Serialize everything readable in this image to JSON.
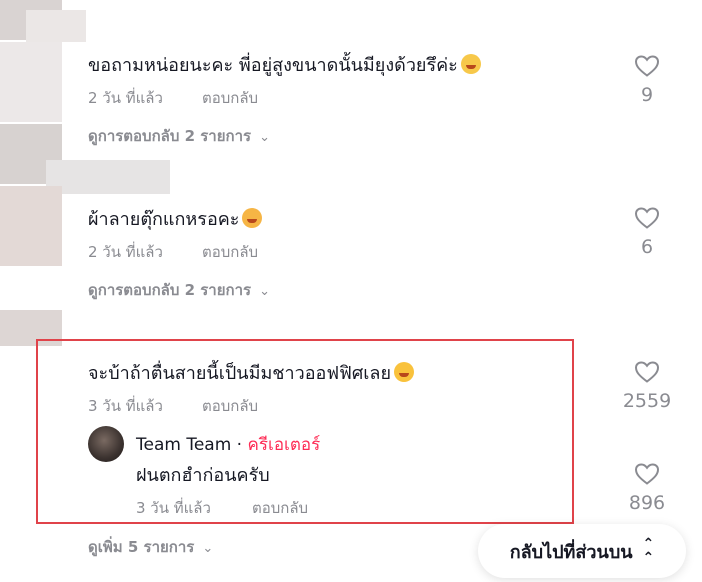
{
  "comments": [
    {
      "text": "ขอถามหน่อยนะคะ พี่อยู่สูงขนาดนั้นมียุงด้วยรึค่ะ",
      "emoji": "smiling-face-with-sweat-emoji",
      "time": "2 วัน ที่แล้ว",
      "reply_label": "ตอบกลับ",
      "likes": "9",
      "view_replies": "ดูการตอบกลับ 2 รายการ"
    },
    {
      "text": "ผ้าลายตุ๊กแกหรอคะ",
      "emoji": "smiling-face-with-hearts-emoji",
      "time": "2 วัน ที่แล้ว",
      "reply_label": "ตอบกลับ",
      "likes": "6",
      "view_replies": "ดูการตอบกลับ 2 รายการ"
    },
    {
      "text": "จะบ้าถ้าตื่นสายนี้เป็นมีมชาวออฟฟิศเลย",
      "emoji": "tears-of-joy-emoji",
      "time": "3 วัน ที่แล้ว",
      "reply_label": "ตอบกลับ",
      "likes": "2559",
      "reply": {
        "author": "Team Team",
        "separator": " · ",
        "badge": "ครีเอเตอร์",
        "text": "ฝนตกฮำก่อนครับ",
        "time": "3 วัน ที่แล้ว",
        "reply_label": "ตอบกลับ",
        "likes": "896"
      },
      "view_more": "ดูเพิ่ม 5 รายการ"
    }
  ],
  "back_to_top": "กลับไปที่ส่วนบน",
  "colors": {
    "text": "#161823",
    "muted": "#8a8b91",
    "creator_badge": "#fe2c55",
    "highlight_border": "#e0434a"
  }
}
